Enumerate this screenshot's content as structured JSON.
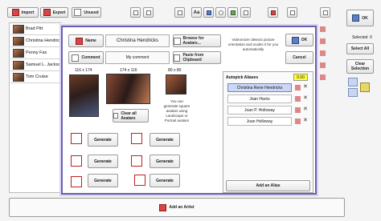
{
  "toolbar": {
    "import_label": "Import",
    "export_label": "Export",
    "unused_label": "Unused",
    "ok_label": "OK"
  },
  "artists": [
    {
      "name": "Brad Pitt"
    },
    {
      "name": "Christina Hendricks"
    },
    {
      "name": "Penny Fax"
    },
    {
      "name": "Samuel L. Jackson"
    },
    {
      "name": "Tom Cruise"
    }
  ],
  "add_artist_label": "Add an Artist",
  "right_panel": {
    "selected_label": "Selected",
    "selected_count": "0",
    "select_all_label": "Select All",
    "clear_selection_label": "Clear Selection"
  },
  "dialog": {
    "name_label": "Name",
    "name_value": "Christina Hendricks",
    "comment_label": "Comment",
    "comment_value": "My comment",
    "browse_label": "Browse for Avatars...",
    "paste_label": "Paste from Clipboard",
    "info_text": "Videomizer detects picture orientation and scales it for you automatically",
    "ok_label": "OK",
    "cancel_label": "Cancel",
    "sizes": [
      "116 x 174",
      "174 x 116",
      "80 x 80"
    ],
    "clear_avatars_label": "Clear all Avatars",
    "square_hint": "You can generate square avatars using Landscape or Portrait avatars",
    "generate_label": "Generate",
    "autopick_label": "Autopick Aliases",
    "autopick_value": "0.00",
    "aliases": [
      "Christina Rene Hendricks",
      "Joan Harris",
      "Joan P. Holloway",
      "Joan Holloway"
    ],
    "add_alias_label": "Add an Alias"
  },
  "colors": {
    "dialog_border": "#6a5fb0",
    "selection_bg": "#cbd7f5",
    "autopick_badge": "#ffff33",
    "generate_box_border": "#c02020"
  }
}
